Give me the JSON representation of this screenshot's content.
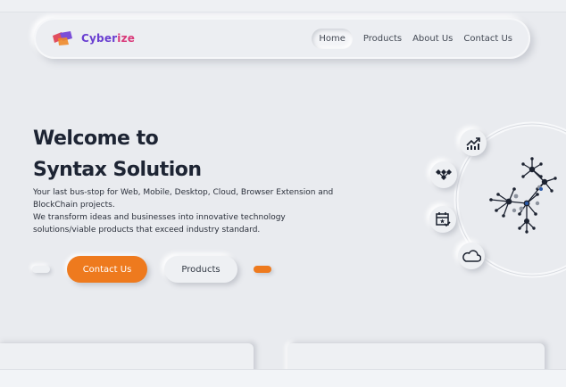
{
  "brand": {
    "name_part1": "Cyber",
    "name_part2": "ize"
  },
  "nav": {
    "items": [
      "Home",
      "Products",
      "About Us",
      "Contact Us"
    ],
    "active": "Home"
  },
  "hero": {
    "title_line1": "Welcome to",
    "title_line2": "Syntax Solution",
    "description_line1": "Your last bus-stop for Web, Mobile, Desktop, Cloud, Browser Extension and BlockChain projects.",
    "description_line2": "We transform ideas and businesses into innovative technology solutions/viable products that exceed industry standard."
  },
  "buttons": {
    "primary": "Contact Us",
    "secondary": "Products"
  },
  "orbit_icons": [
    "trending-up-icon",
    "nodes-icon",
    "calendar-check-icon",
    "cloud-icon"
  ],
  "colors": {
    "accent": "#ee7a1e",
    "brand_purple": "#6a3fd1",
    "brand_pink": "#d93a7a",
    "background": "#e9ebef"
  }
}
